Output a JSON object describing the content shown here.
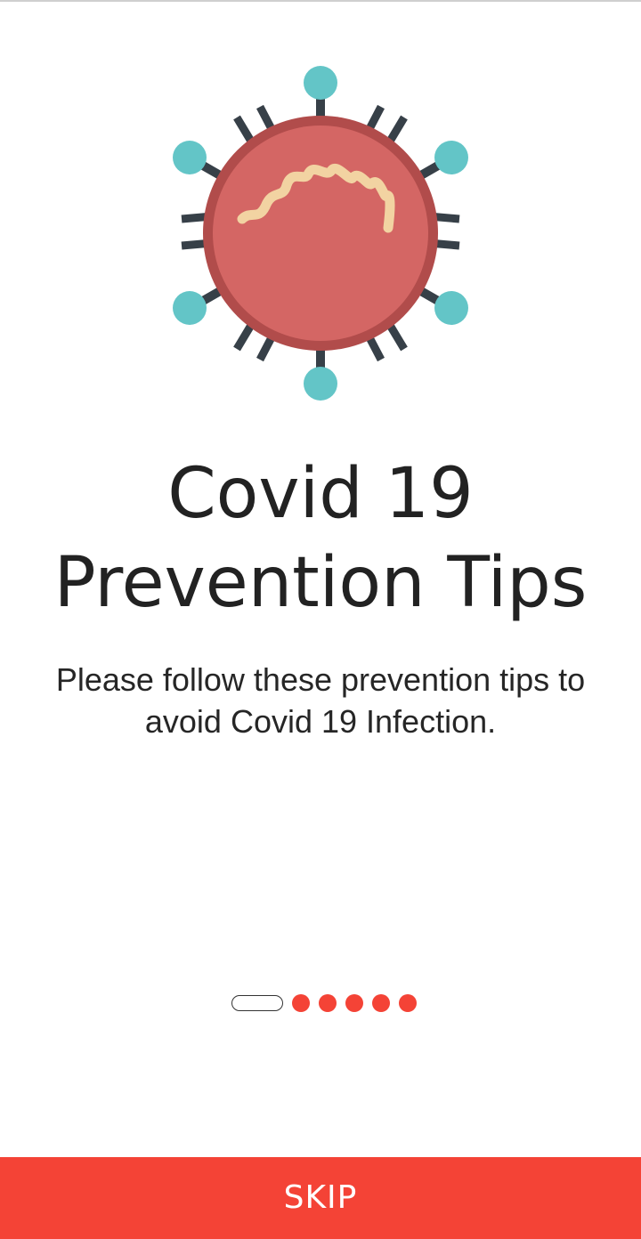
{
  "onboarding": {
    "illustration": "virus-icon",
    "title_line1": "Covid 19",
    "title_line2": "Prevention Tips",
    "subtitle": "Please follow these prevention tips to avoid Covid 19 Infection.",
    "pager": {
      "total_pages": 6,
      "current_page": 1
    },
    "skip_label": "SKIP"
  },
  "colors": {
    "accent": "#f44336",
    "virus_body": "#d46664",
    "virus_ring": "#b14c4b",
    "spike": "#374048",
    "spike_tip": "#63c5c7",
    "rna": "#f2d3a2"
  }
}
